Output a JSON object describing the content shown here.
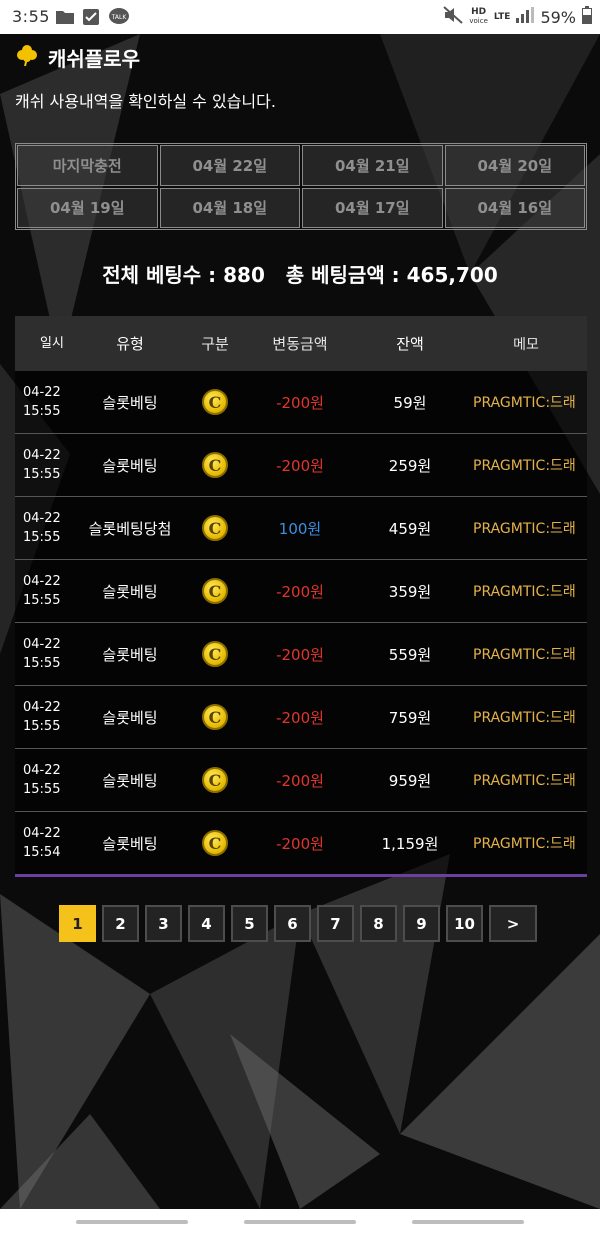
{
  "status_bar": {
    "time": "3:55",
    "hd": "HD",
    "voice": "voice",
    "lte": "LTE",
    "battery": "59%",
    "icons": [
      "folder-icon",
      "checkbox-icon",
      "talk-icon",
      "mute-icon",
      "signal-icon",
      "battery-icon"
    ]
  },
  "header": {
    "icon": "clover-icon",
    "title": "캐쉬플로우"
  },
  "subtitle": "캐쉬 사용내역을 확인하실 수 있습니다.",
  "date_tabs": [
    "마지막충전",
    "04월 22일",
    "04월 21일",
    "04월 20일",
    "04월 19일",
    "04월 18일",
    "04월 17일",
    "04월 16일"
  ],
  "summary": "전체 베팅수 : 880   총 베팅금액 : 465,700",
  "table": {
    "headers": [
      "일시",
      "유형",
      "구분",
      "변동금액",
      "잔액",
      "메모"
    ],
    "rows": [
      {
        "date": "04-22",
        "time": "15:55",
        "type": "슬롯베팅",
        "kind": "C",
        "amount": "-200원",
        "balance": "59원",
        "memo": "PRAGMTIC:드래"
      },
      {
        "date": "04-22",
        "time": "15:55",
        "type": "슬롯베팅",
        "kind": "C",
        "amount": "-200원",
        "balance": "259원",
        "memo": "PRAGMTIC:드래"
      },
      {
        "date": "04-22",
        "time": "15:55",
        "type": "슬롯베팅당첨",
        "kind": "C",
        "amount": "100원",
        "balance": "459원",
        "memo": "PRAGMTIC:드래"
      },
      {
        "date": "04-22",
        "time": "15:55",
        "type": "슬롯베팅",
        "kind": "C",
        "amount": "-200원",
        "balance": "359원",
        "memo": "PRAGMTIC:드래"
      },
      {
        "date": "04-22",
        "time": "15:55",
        "type": "슬롯베팅",
        "kind": "C",
        "amount": "-200원",
        "balance": "559원",
        "memo": "PRAGMTIC:드래"
      },
      {
        "date": "04-22",
        "time": "15:55",
        "type": "슬롯베팅",
        "kind": "C",
        "amount": "-200원",
        "balance": "759원",
        "memo": "PRAGMTIC:드래"
      },
      {
        "date": "04-22",
        "time": "15:55",
        "type": "슬롯베팅",
        "kind": "C",
        "amount": "-200원",
        "balance": "959원",
        "memo": "PRAGMTIC:드래"
      },
      {
        "date": "04-22",
        "time": "15:54",
        "type": "슬롯베팅",
        "kind": "C",
        "amount": "-200원",
        "balance": "1,159원",
        "memo": "PRAGMTIC:드래"
      }
    ]
  },
  "pagination": {
    "pages": [
      "1",
      "2",
      "3",
      "4",
      "5",
      "6",
      "7",
      "8",
      "9",
      "10"
    ],
    "current": "1",
    "next": ">"
  },
  "colors": {
    "accent": "#f4c21a",
    "negative": "#e0362c",
    "positive": "#3a8fe0",
    "memo": "#e3b24a",
    "table_bottom_border": "#6b3fa0"
  }
}
